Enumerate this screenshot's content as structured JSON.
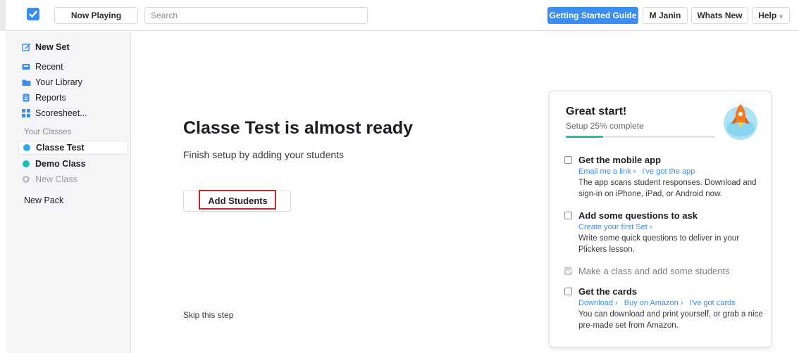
{
  "header": {
    "now_playing": "Now Playing",
    "search_placeholder": "Search",
    "getting_started": "Getting Started Guide",
    "user": "M Janin",
    "whats_new": "Whats New",
    "help": "Help"
  },
  "sidebar": {
    "new_set": "New Set",
    "recent": "Recent",
    "library": "Your Library",
    "reports": "Reports",
    "scoresheet": "Scoresheet...",
    "classes_heading": "Your Classes",
    "classes": [
      {
        "label": "Classe Test",
        "color": "#2fa8f0"
      },
      {
        "label": "Demo Class",
        "color": "#16c0b6"
      }
    ],
    "new_class": "New Class",
    "new_pack": "New Pack"
  },
  "main": {
    "title": "Classe Test is almost ready",
    "subtitle": "Finish setup by adding your students",
    "add_students": "Add Students",
    "skip": "Skip this step"
  },
  "card": {
    "title": "Great start!",
    "progress_text": "Setup 25% complete",
    "progress_fraction": 0.25,
    "tasks": [
      {
        "title": "Get the mobile app",
        "links": [
          "Email me a link",
          "I've got the app"
        ],
        "desc": "The app scans student responses. Download and sign-in on iPhone, iPad, or Android now."
      },
      {
        "title": "Add some questions to ask",
        "links": [
          "Create your first Set"
        ],
        "desc": "Write some quick questions to deliver in your Plickers lesson."
      },
      {
        "title": "Make a class and add some students",
        "done": true
      },
      {
        "title": "Get the cards",
        "links": [
          "Download",
          "Buy on Amazon",
          "I've got cards"
        ],
        "desc": "You can download and print yourself, or grab a nice pre-made set from Amazon."
      }
    ]
  },
  "colors": {
    "accent": "#3a8ef2",
    "progress": "#17c0b0",
    "highlight": "#c62828"
  }
}
